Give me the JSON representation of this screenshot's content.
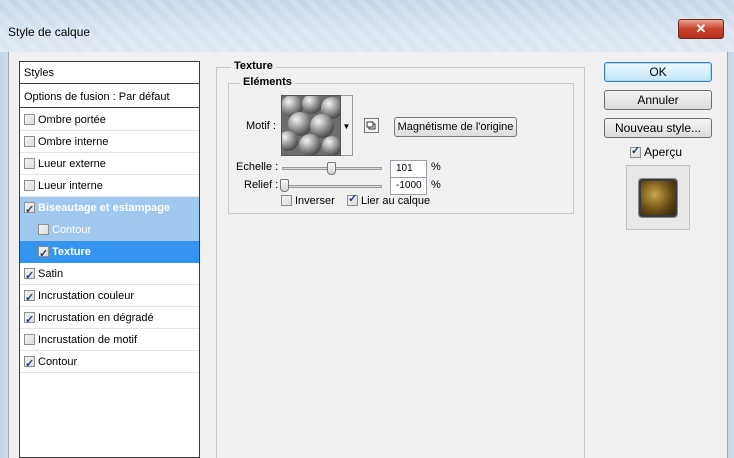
{
  "window": {
    "title": "Style de calque",
    "close_symbol": "✕"
  },
  "styles_panel": {
    "header": "Styles",
    "blend_options": "Options de fusion : Par défaut",
    "items": [
      {
        "label": "Ombre portée",
        "checked": false,
        "state": "normal"
      },
      {
        "label": "Ombre interne",
        "checked": false,
        "state": "normal"
      },
      {
        "label": "Lueur externe",
        "checked": false,
        "state": "normal"
      },
      {
        "label": "Lueur interne",
        "checked": false,
        "state": "normal"
      },
      {
        "label": "Biseautage et estampage",
        "checked": true,
        "state": "selected"
      },
      {
        "label": "Contour",
        "checked": false,
        "state": "sub"
      },
      {
        "label": "Texture",
        "checked": true,
        "state": "sub-active"
      },
      {
        "label": "Satin",
        "checked": true,
        "state": "normal"
      },
      {
        "label": "Incrustation couleur",
        "checked": true,
        "state": "normal"
      },
      {
        "label": "Incrustation en dégradé",
        "checked": true,
        "state": "normal"
      },
      {
        "label": "Incrustation de motif",
        "checked": false,
        "state": "normal"
      },
      {
        "label": "Contour",
        "checked": true,
        "state": "normal"
      }
    ]
  },
  "texture": {
    "group_title": "Texture",
    "elements_title": "Eléments",
    "motif_label": "Motif :",
    "snap_button": "Magnétisme de l'origine",
    "scale_label": "Echelle :",
    "scale_value": "101",
    "scale_unit": "%",
    "scale_level": 0.101,
    "depth_label": "Relief :",
    "depth_value": "-1000",
    "depth_unit": "%",
    "depth_level": 0.0,
    "invert_label": "Inverser",
    "invert_checked": false,
    "link_label": "Lier au calque",
    "link_checked": true
  },
  "buttons": {
    "ok": "OK",
    "cancel": "Annuler",
    "new_style": "Nouveau style...",
    "preview_label": "Aperçu",
    "preview_checked": true
  },
  "icons": {
    "close": "close-icon",
    "checkbox": "checkbox-icon",
    "dropdown": "chevron-down-icon",
    "new_preset": "new-preset-icon"
  }
}
